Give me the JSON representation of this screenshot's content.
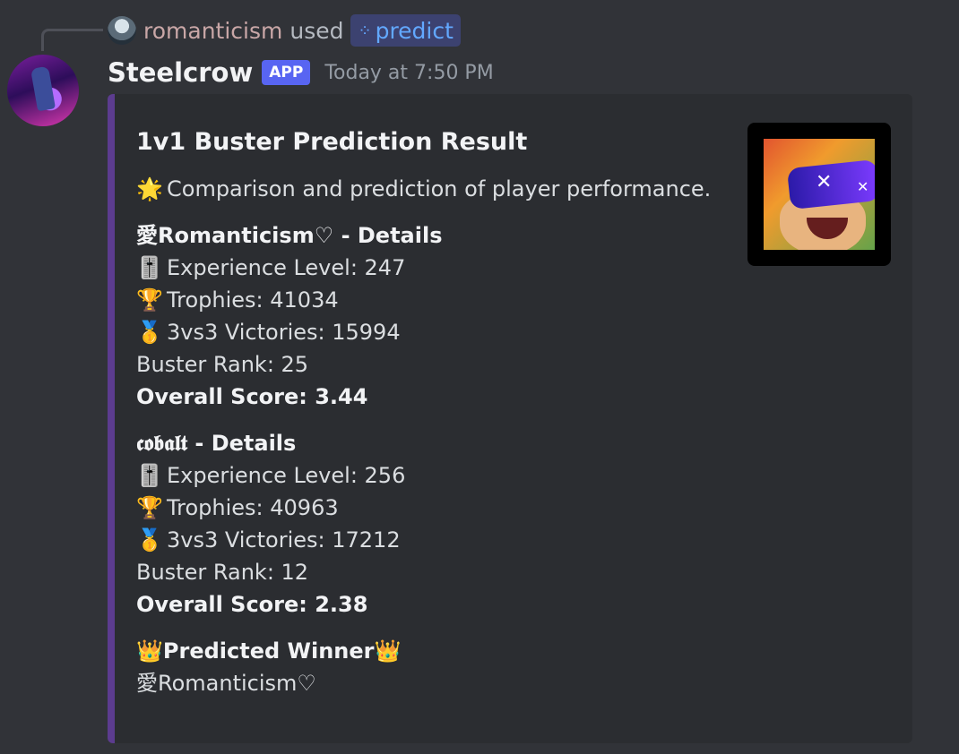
{
  "reply": {
    "username": "romanticism",
    "used_text": "used",
    "command": "predict"
  },
  "message": {
    "bot_name": "Steelcrow",
    "badge": "APP",
    "timestamp": "Today at 7:50 PM"
  },
  "embed": {
    "accent_color": "#5c3c8f",
    "title": "1v1 Buster Prediction Result",
    "description_emoji": "🌟",
    "description": "Comparison and prediction of player performance.",
    "players": [
      {
        "field_name": "愛Romanticism♡ - Details",
        "experience_emoji": "🎚️",
        "experience": "Experience Level: 247",
        "trophies_emoji": "🏆",
        "trophies": "Trophies: 41034",
        "victories_emoji": "🥇",
        "victories": "3vs3 Victories: 15994",
        "rank": "Buster Rank: 25",
        "score": "Overall Score: 3.44"
      },
      {
        "field_name": "𝖈𝖔𝖇𝖆𝖑𝖙 - Details",
        "experience_emoji": "🎚️",
        "experience": "Experience Level: 256",
        "trophies_emoji": "🏆",
        "trophies": "Trophies: 40963",
        "victories_emoji": "🥇",
        "victories": "3vs3 Victories: 17212",
        "rank": "Buster Rank: 12",
        "score": "Overall Score: 2.38"
      }
    ],
    "winner": {
      "crown_emoji": "👑",
      "label": "Predicted Winner",
      "name": "愛Romanticism♡"
    }
  }
}
